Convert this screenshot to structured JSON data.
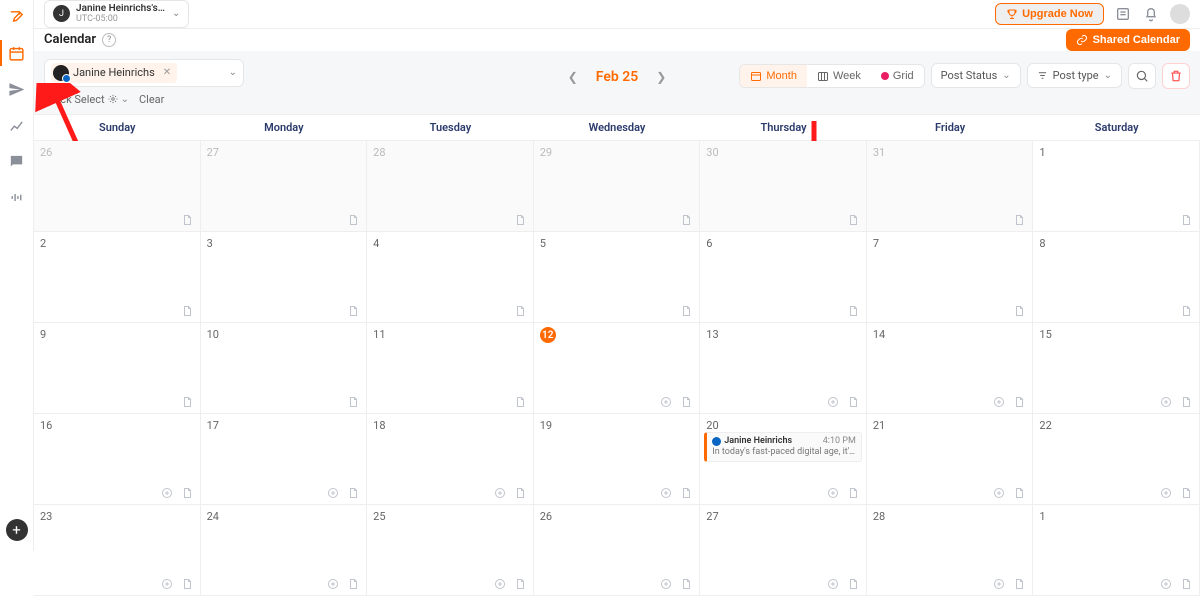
{
  "workspace": {
    "avatar_letter": "J",
    "name": "Janine Heinrichs's …",
    "timezone": "UTC-05:00"
  },
  "topbar": {
    "upgrade_label": "Upgrade Now"
  },
  "page": {
    "title": "Calendar",
    "shared_button": "Shared Calendar"
  },
  "profile": {
    "name": "Janine Heinrichs"
  },
  "quick": {
    "select_label": "Quick Select",
    "clear_label": "Clear"
  },
  "nav": {
    "current": "Feb 25"
  },
  "views": {
    "month": "Month",
    "week": "Week",
    "grid": "Grid"
  },
  "filters": {
    "post_status": "Post Status",
    "post_type": "Post type"
  },
  "dow": [
    "Sunday",
    "Monday",
    "Tuesday",
    "Wednesday",
    "Thursday",
    "Friday",
    "Saturday"
  ],
  "weeks": [
    [
      {
        "n": "26",
        "dim": true,
        "doc": true
      },
      {
        "n": "27",
        "dim": true,
        "doc": true
      },
      {
        "n": "28",
        "dim": true,
        "doc": true
      },
      {
        "n": "29",
        "dim": true,
        "doc": true
      },
      {
        "n": "30",
        "dim": true,
        "doc": true
      },
      {
        "n": "31",
        "dim": true,
        "doc": true
      },
      {
        "n": "1",
        "doc": true
      }
    ],
    [
      {
        "n": "2",
        "doc": true
      },
      {
        "n": "3",
        "doc": true
      },
      {
        "n": "4",
        "doc": true
      },
      {
        "n": "5",
        "doc": true
      },
      {
        "n": "6",
        "doc": true
      },
      {
        "n": "7",
        "doc": true
      },
      {
        "n": "8",
        "doc": true
      }
    ],
    [
      {
        "n": "9",
        "doc": true
      },
      {
        "n": "10",
        "doc": true
      },
      {
        "n": "11",
        "doc": true
      },
      {
        "n": "12",
        "today": true,
        "plus": true,
        "doc": true
      },
      {
        "n": "13",
        "plus": true,
        "doc": true
      },
      {
        "n": "14",
        "plus": true,
        "doc": true
      },
      {
        "n": "15",
        "plus": true,
        "doc": true
      }
    ],
    [
      {
        "n": "16",
        "plus": true,
        "doc": true
      },
      {
        "n": "17",
        "plus": true,
        "doc": true
      },
      {
        "n": "18",
        "plus": true,
        "doc": true
      },
      {
        "n": "19",
        "plus": true,
        "doc": true
      },
      {
        "n": "20",
        "plus": true,
        "doc": true,
        "post": {
          "author": "Janine Heinrichs",
          "time": "4:10 PM",
          "text": "In today's fast-paced digital age, it's crucial to …"
        }
      },
      {
        "n": "21",
        "plus": true,
        "doc": true
      },
      {
        "n": "22",
        "plus": true,
        "doc": true
      }
    ],
    [
      {
        "n": "23",
        "plus": true,
        "doc": true
      },
      {
        "n": "24",
        "plus": true,
        "doc": true
      },
      {
        "n": "25",
        "plus": true,
        "doc": true
      },
      {
        "n": "26",
        "plus": true,
        "doc": true
      },
      {
        "n": "27",
        "plus": true,
        "doc": true
      },
      {
        "n": "28",
        "plus": true,
        "doc": true
      },
      {
        "n": "1",
        "plus": true,
        "doc": true
      }
    ]
  ]
}
